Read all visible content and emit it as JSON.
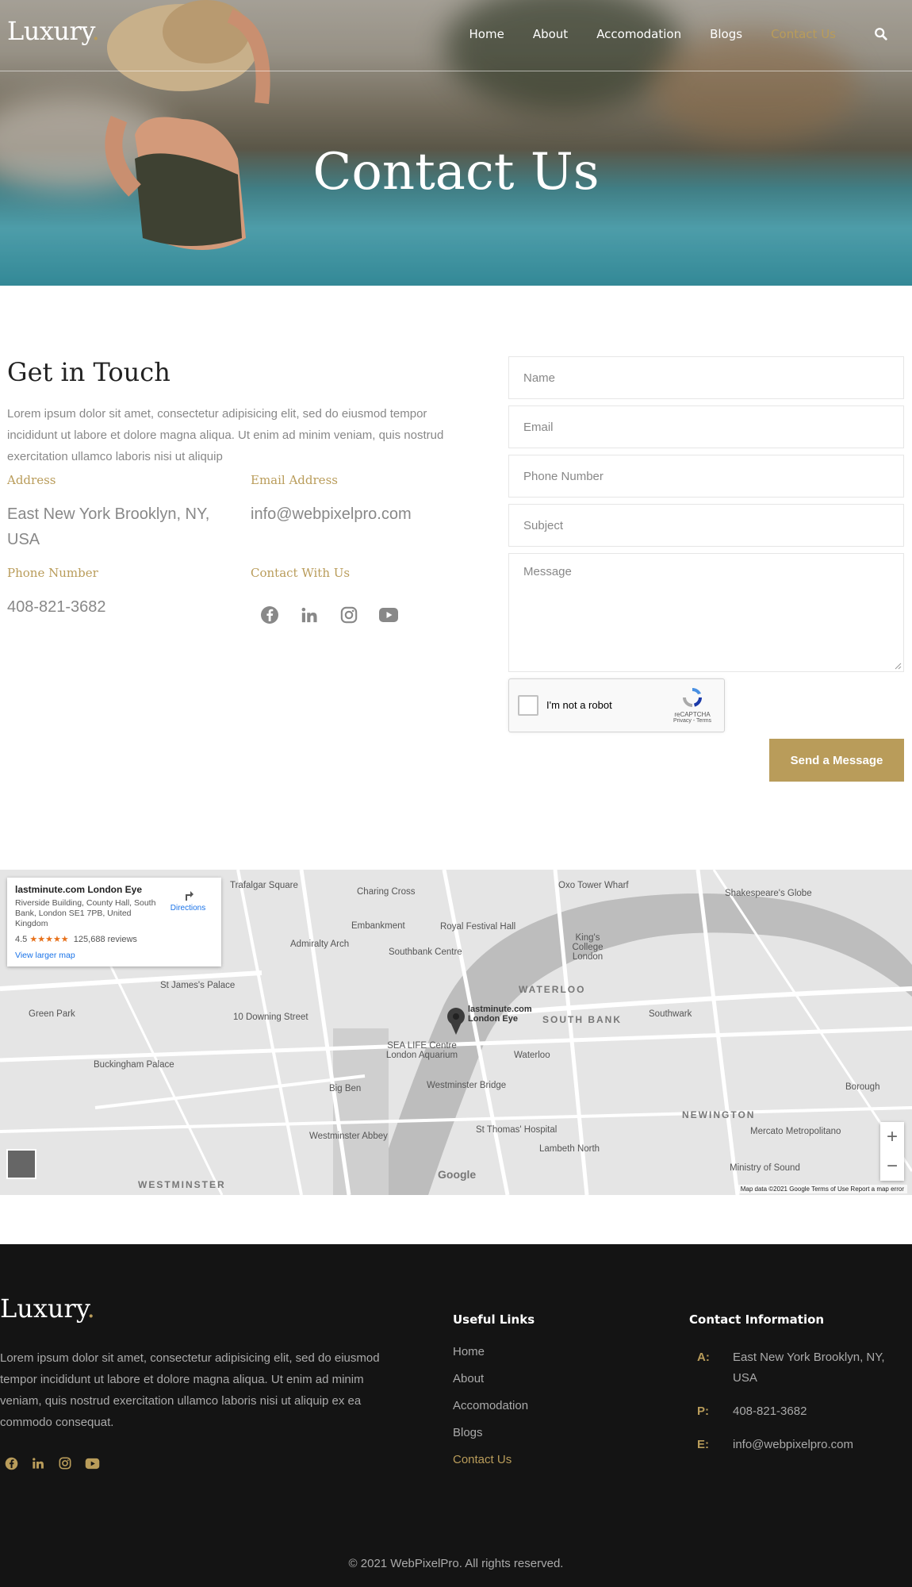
{
  "header": {
    "logo_text": "Luxury",
    "logo_dot": ".",
    "nav": [
      {
        "label": "Home",
        "active": false
      },
      {
        "label": "About",
        "active": false
      },
      {
        "label": "Accomodation",
        "active": false
      },
      {
        "label": "Blogs",
        "active": false
      },
      {
        "label": "Contact Us",
        "active": true
      }
    ],
    "search_icon": "search-icon"
  },
  "hero": {
    "title": "Contact Us"
  },
  "contact": {
    "heading": "Get in Touch",
    "lead": "Lorem ipsum dolor sit amet, consectetur adipisicing elit, sed do eiusmod tempor incididunt ut labore et dolore magna aliqua. Ut enim ad minim veniam, quis nostrud exercitation ullamco laboris nisi ut aliquip",
    "address_label": "Address",
    "address_value": "East New York Brooklyn, NY, USA",
    "email_label": "Email Address",
    "email_value": "info@webpixelpro.com",
    "phone_label": "Phone Number",
    "phone_value": "408-821-3682",
    "social_label": "Contact With Us",
    "socials": [
      "facebook-icon",
      "linkedin-icon",
      "instagram-icon",
      "youtube-icon"
    ]
  },
  "form": {
    "name_placeholder": "Name",
    "email_placeholder": "Email",
    "phone_placeholder": "Phone Number",
    "subject_placeholder": "Subject",
    "message_placeholder": "Message",
    "captcha_label": "I'm not a robot",
    "captcha_brand": "reCAPTCHA",
    "captcha_links": "Privacy - Terms",
    "submit_label": "Send a Message"
  },
  "map": {
    "place_title": "lastminute.com London Eye",
    "place_address": "Riverside Building, County Hall, South Bank, London SE1 7PB, United Kingdom",
    "rating": "4.5",
    "reviews": "125,688 reviews",
    "directions_label": "Directions",
    "larger_map_label": "View larger map",
    "labels": [
      "Trafalgar Square",
      "Charing Cross",
      "Embankment",
      "Royal Festival Hall",
      "Admiralty Arch",
      "Southbank Centre",
      "King's College London",
      "WATERLOO",
      "SOUTH BANK",
      "St James's Palace",
      "Green Park",
      "10 Downing Street",
      "SEA LIFE Centre London Aquarium",
      "Waterloo",
      "Buckingham Palace",
      "Big Ben",
      "Westminster Bridge",
      "NEWINGTON",
      "Westminster Abbey",
      "St Thomas' Hospital",
      "Lambeth North",
      "WESTMINSTER",
      "Oxo Tower Wharf",
      "Shakespeare's Globe",
      "Southwark",
      "Borough",
      "Mercato Metropolitano",
      "Ministry of Sound",
      "lastminute.com London Eye"
    ],
    "footer_text": "Map data ©2021 Google   Terms of Use   Report a map error",
    "google_text": "Google"
  },
  "footer": {
    "logo_text": "Luxury",
    "logo_dot": ".",
    "description": "Lorem ipsum dolor sit amet, consectetur adipisicing elit, sed do eiusmod tempor incididunt ut labore et dolore magna aliqua. Ut enim ad minim veniam, quis nostrud exercitation ullamco laboris nisi ut aliquip ex ea commodo consequat.",
    "useful_links_title": "Useful Links",
    "links": [
      {
        "label": "Home",
        "active": false
      },
      {
        "label": "About",
        "active": false
      },
      {
        "label": "Accomodation",
        "active": false
      },
      {
        "label": "Blogs",
        "active": false
      },
      {
        "label": "Contact Us",
        "active": true
      }
    ],
    "contact_title": "Contact Information",
    "contact_rows": [
      {
        "key": "A:",
        "value": "East New York Brooklyn, NY, USA"
      },
      {
        "key": "P:",
        "value": "408-821-3682"
      },
      {
        "key": "E:",
        "value": "info@webpixelpro.com"
      }
    ],
    "copyright": "© 2021 WebPixelPro. All rights reserved."
  },
  "colors": {
    "accent": "#b99c5a",
    "footer_bg": "#141414"
  }
}
